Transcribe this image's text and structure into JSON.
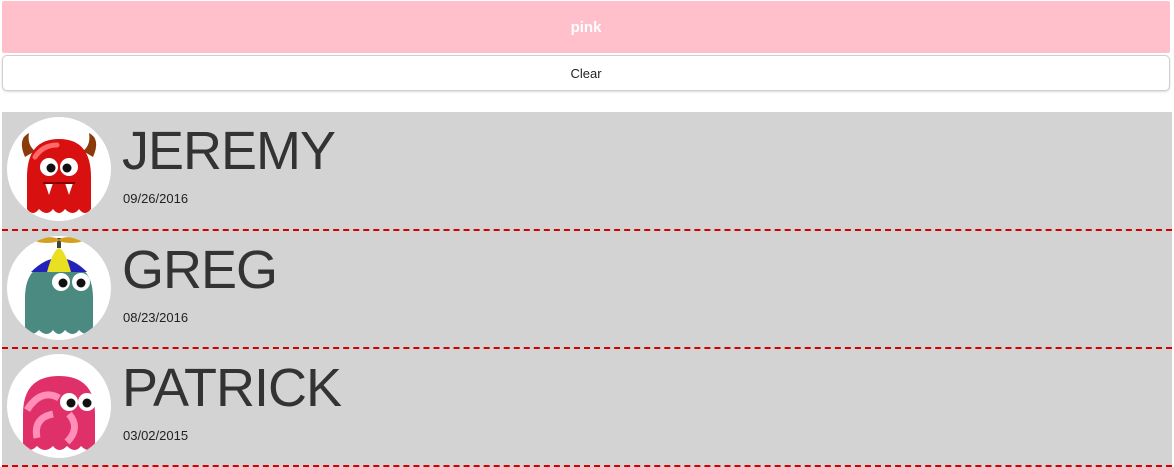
{
  "color_button": {
    "label": "pink",
    "color": "#ffc0cb"
  },
  "clear_button": {
    "label": "Clear"
  },
  "list": {
    "background": "#d3d3d3",
    "separator_color": "#d40000",
    "items": [
      {
        "name": "JEREMY",
        "date": "09/26/2016",
        "avatar_icon": "red-devil-monster-icon"
      },
      {
        "name": "GREG",
        "date": "08/23/2016",
        "avatar_icon": "propeller-hat-monster-icon"
      },
      {
        "name": "PATRICK",
        "date": "03/02/2015",
        "avatar_icon": "pink-swirl-monster-icon"
      }
    ]
  }
}
